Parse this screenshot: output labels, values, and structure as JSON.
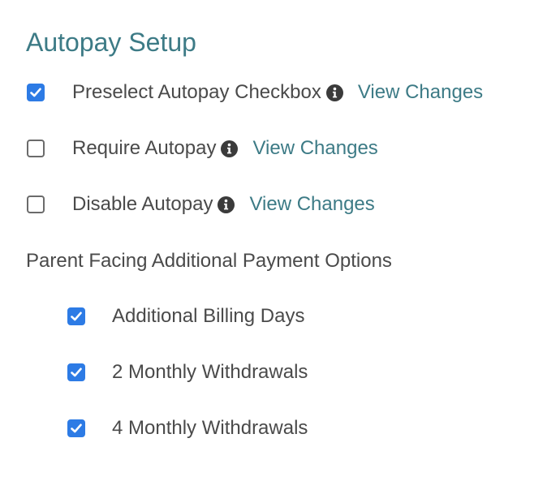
{
  "title": "Autopay Setup",
  "options": [
    {
      "label": "Preselect Autopay Checkbox",
      "checked": true,
      "link": "View Changes"
    },
    {
      "label": "Require Autopay",
      "checked": false,
      "link": "View Changes"
    },
    {
      "label": "Disable Autopay",
      "checked": false,
      "link": "View Changes"
    }
  ],
  "section_label": "Parent Facing Additional Payment Options",
  "additional_options": [
    {
      "label": "Additional Billing Days",
      "checked": true
    },
    {
      "label": "2 Monthly Withdrawals",
      "checked": true
    },
    {
      "label": "4 Monthly Withdrawals",
      "checked": true
    }
  ],
  "colors": {
    "accent": "#3d7b86",
    "checkbox": "#2d7be5",
    "text": "#4a4a4a"
  },
  "icons": {
    "check": "check-icon",
    "info": "info-icon"
  }
}
